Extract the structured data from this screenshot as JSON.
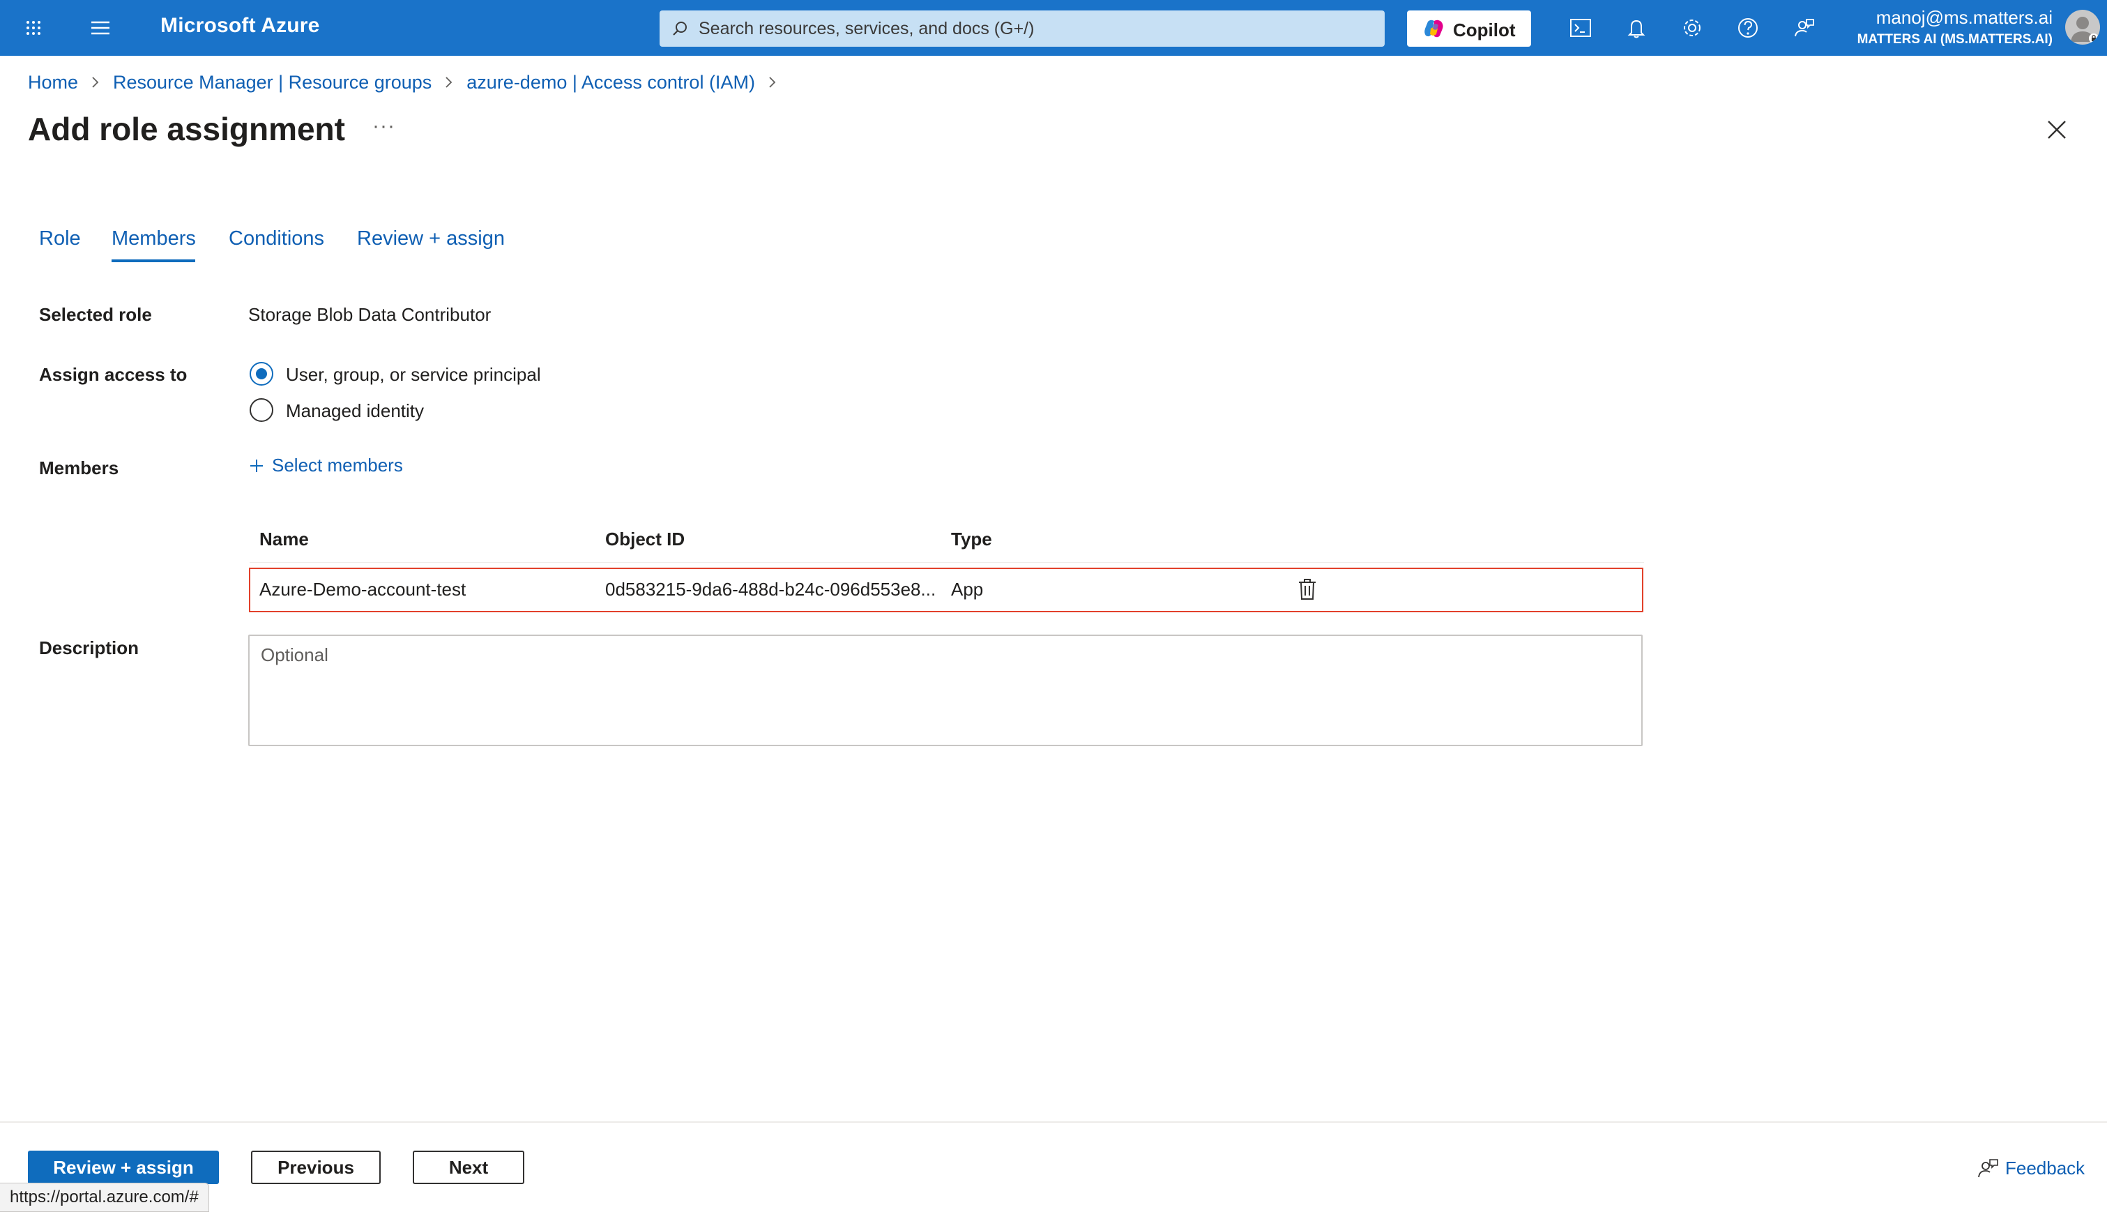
{
  "topbar": {
    "brand": "Microsoft Azure",
    "search_placeholder": "Search resources, services, and docs (G+/)",
    "copilot_label": "Copilot",
    "user_email": "manoj@ms.matters.ai",
    "user_tenant": "MATTERS AI (MS.MATTERS.AI)",
    "icons": [
      "app-launcher-icon",
      "hamburger-menu-icon",
      "search-icon",
      "cloud-shell-icon",
      "bell-icon",
      "gear-icon",
      "help-icon",
      "feedback-icon"
    ]
  },
  "breadcrumb": {
    "items": [
      "Home",
      "Resource Manager | Resource groups",
      "azure-demo | Access control (IAM)"
    ]
  },
  "page": {
    "title": "Add role assignment",
    "more_label": "···"
  },
  "tabs": [
    "Role",
    "Members",
    "Conditions",
    "Review + assign"
  ],
  "active_tab": "Members",
  "form": {
    "selected_role_label": "Selected role",
    "selected_role_value": "Storage Blob Data Contributor",
    "assign_access_label": "Assign access to",
    "assign_options": [
      "User, group, or service principal",
      "Managed identity"
    ],
    "assign_selected": "User, group, or service principal",
    "members_label": "Members",
    "select_members_label": "Select members",
    "description_label": "Description",
    "description_placeholder": "Optional"
  },
  "members_table": {
    "columns": [
      "Name",
      "Object ID",
      "Type"
    ],
    "rows": [
      {
        "name": "Azure-Demo-account-test",
        "object_id": "0d583215-9da6-488d-b24c-096d553e8...",
        "type": "App"
      }
    ]
  },
  "footer": {
    "review_assign": "Review + assign",
    "previous": "Previous",
    "next": "Next",
    "feedback": "Feedback"
  },
  "status_bar_url": "https://portal.azure.com/#",
  "colors": {
    "topbar": "#1a73c9",
    "accent": "#0f6cbd",
    "highlight_border": "#e2412b"
  }
}
